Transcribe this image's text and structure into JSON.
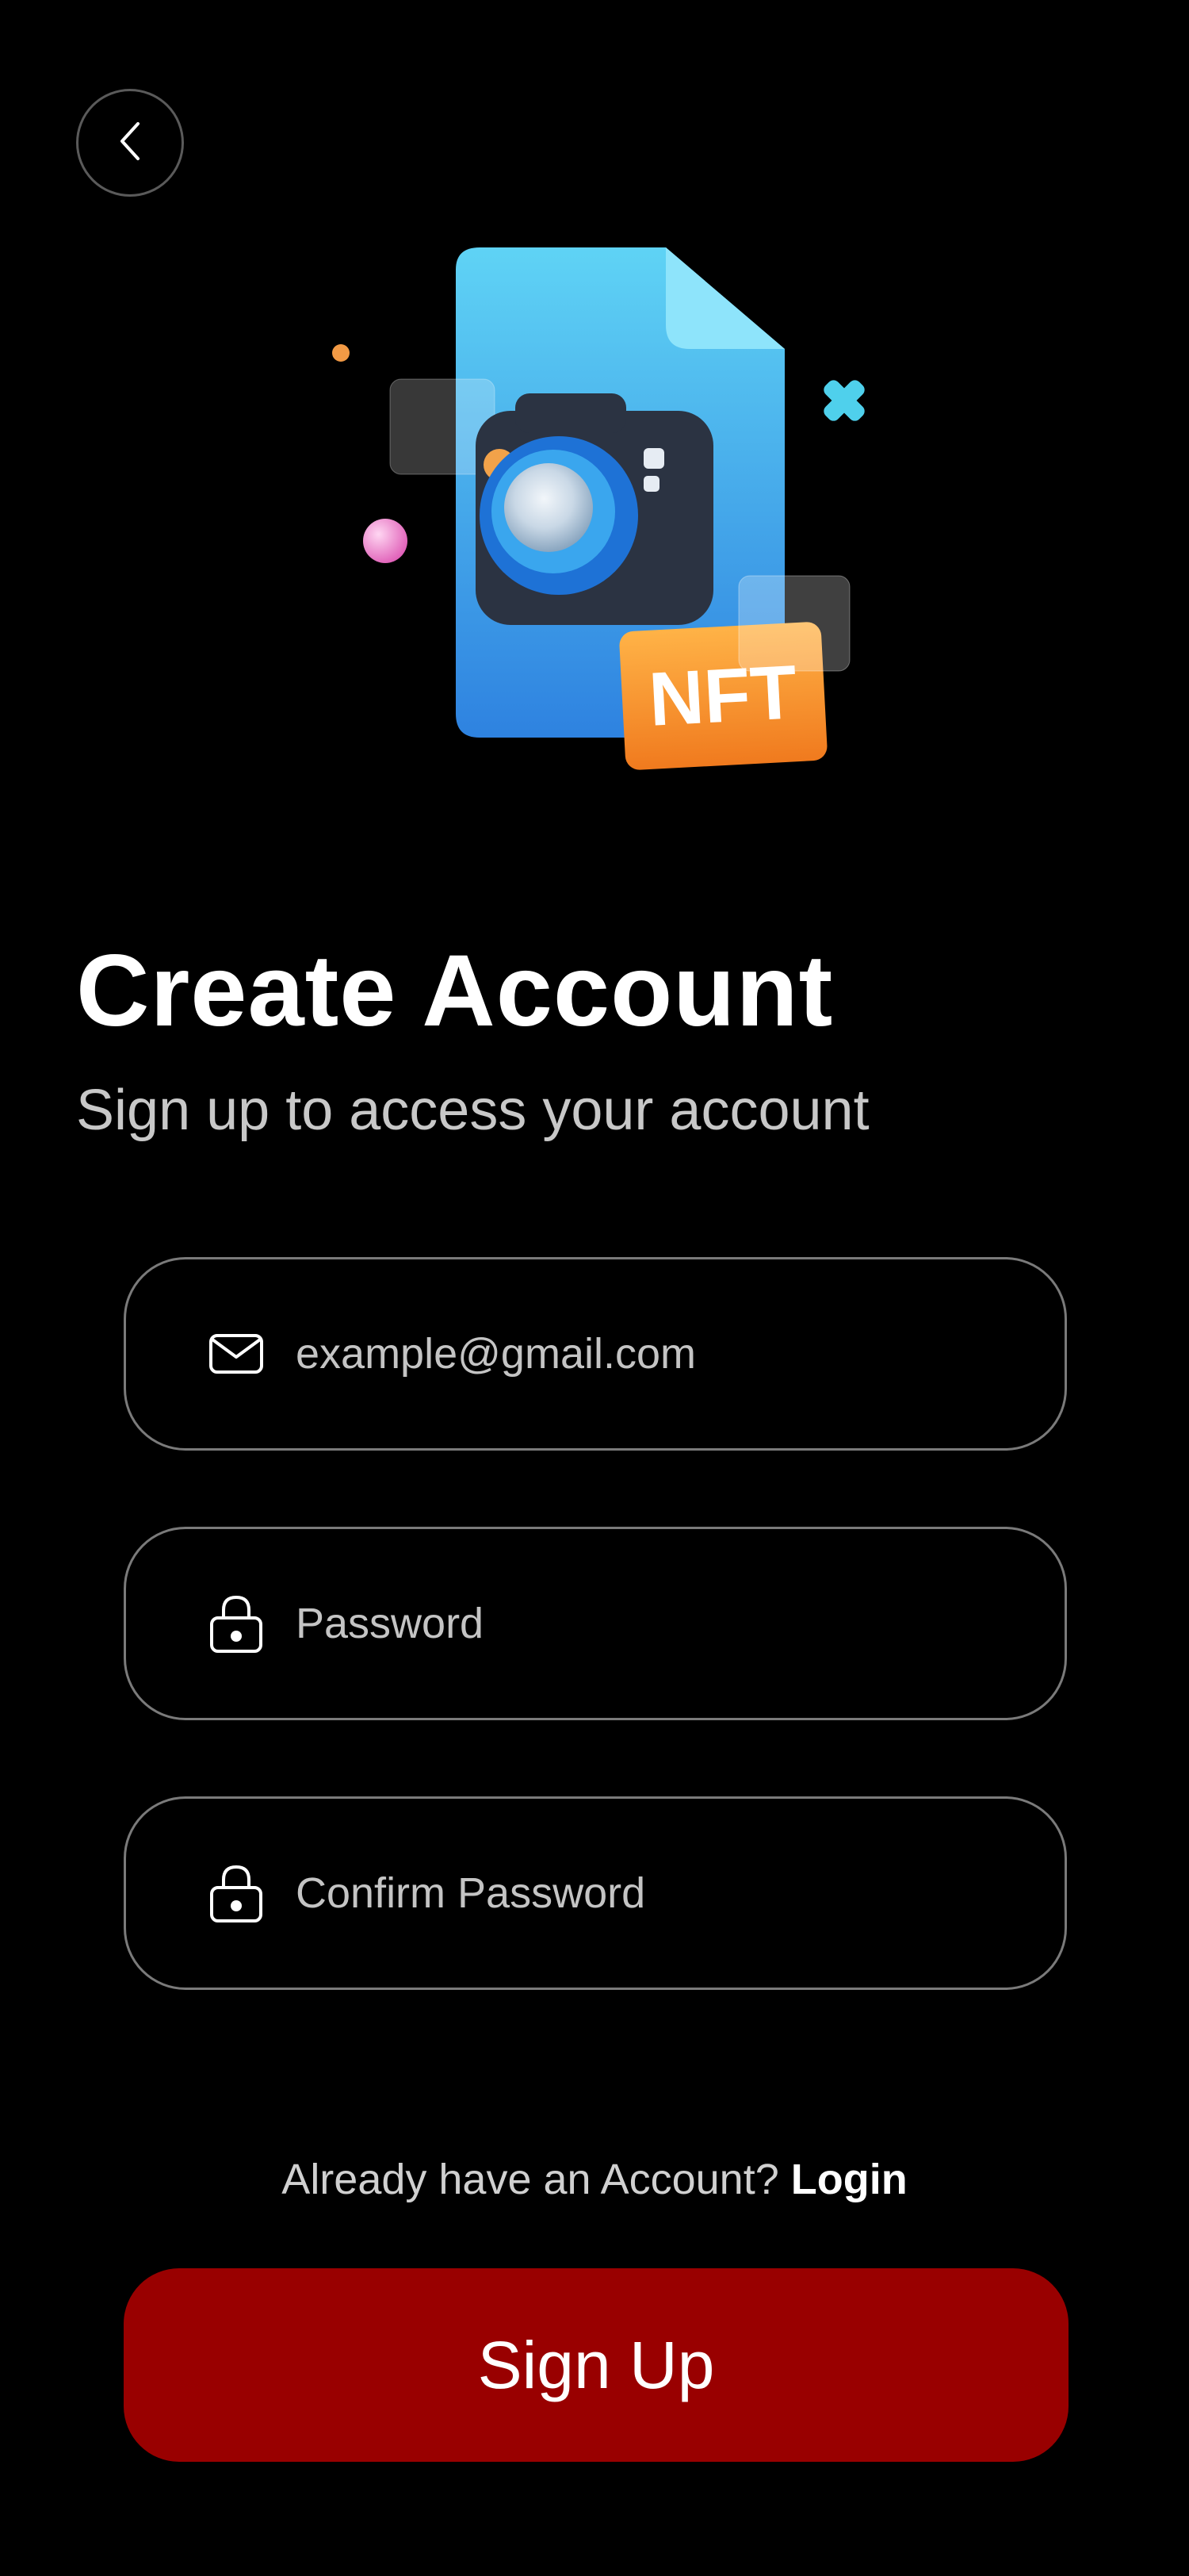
{
  "header": {
    "back_icon": "chevron-left-icon"
  },
  "illustration": {
    "badge_text": "NFT"
  },
  "heading": {
    "title": "Create Account",
    "subtitle": "Sign up to access your account"
  },
  "form": {
    "email": {
      "placeholder": "example@gmail.com",
      "value": "",
      "icon": "mail-icon"
    },
    "password": {
      "placeholder": "Password",
      "value": "",
      "icon": "lock-icon"
    },
    "confirm_password": {
      "placeholder": "Confirm Password",
      "value": "",
      "icon": "lock-icon"
    }
  },
  "footer": {
    "login_prompt": "Already have an Account?",
    "login_link": "Login",
    "signup_label": "Sign Up"
  },
  "colors": {
    "background": "#000000",
    "primary_button": "#990000",
    "field_border": "#7a7a7a",
    "muted_text": "#c8c8c8"
  }
}
